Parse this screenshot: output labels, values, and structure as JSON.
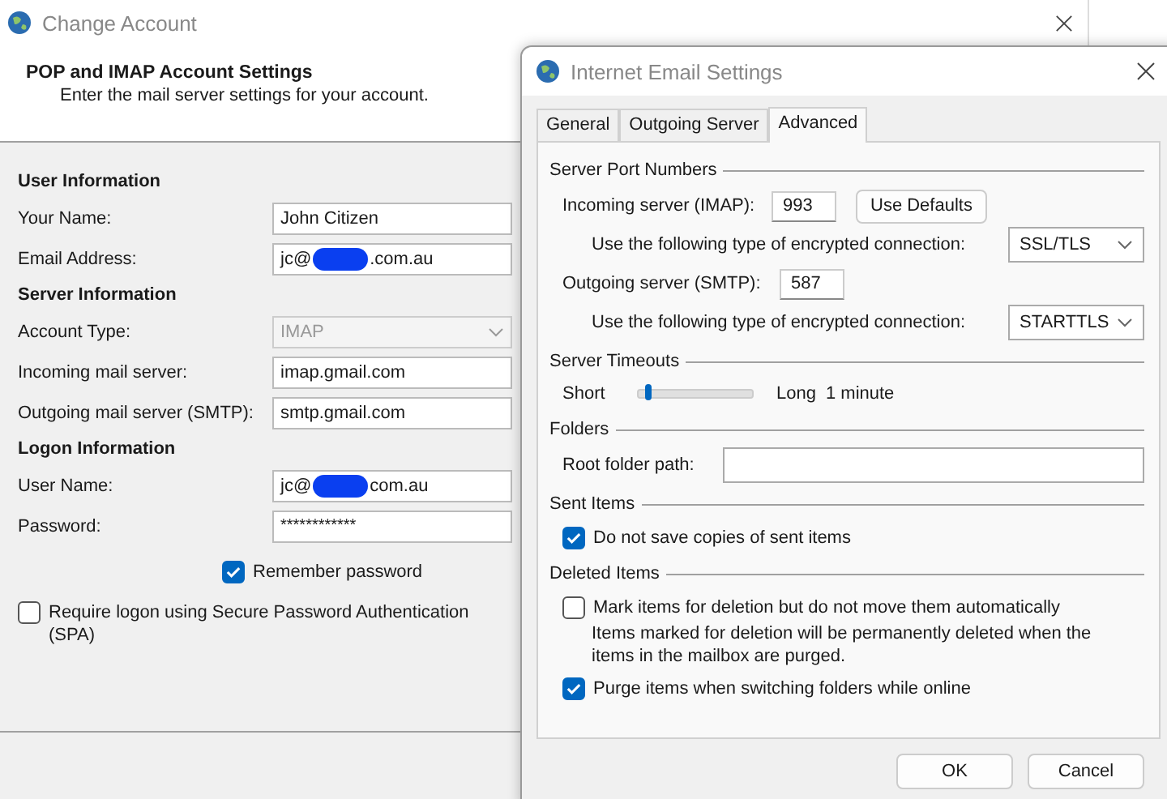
{
  "back_window": {
    "title": "Change Account",
    "heading": "POP and IMAP Account Settings",
    "subheading": "Enter the mail server settings for your account.",
    "sections": [
      {
        "title": "User Information",
        "rows": [
          {
            "label": "Your Name:",
            "kind": "text",
            "value": "John Citizen"
          },
          {
            "label": "Email Address:",
            "kind": "redacted",
            "prefix": "jc@",
            "suffix": ".com.au"
          }
        ]
      },
      {
        "title": "Server Information",
        "rows": [
          {
            "label": "Account Type:",
            "kind": "select",
            "value": "IMAP",
            "disabled": true
          },
          {
            "label": "Incoming mail server:",
            "kind": "text",
            "value": "imap.gmail.com"
          },
          {
            "label": "Outgoing mail server (SMTP):",
            "kind": "text",
            "value": "smtp.gmail.com"
          }
        ]
      },
      {
        "title": "Logon Information",
        "rows": [
          {
            "label": "User Name:",
            "kind": "redacted",
            "prefix": "jc@",
            "suffix": "com.au"
          },
          {
            "label": "Password:",
            "kind": "password",
            "value": "************"
          }
        ]
      }
    ],
    "remember": {
      "label": "Remember password",
      "checked": true
    },
    "spa": {
      "label": "Require logon using Secure Password Authentication (SPA)",
      "checked": false
    }
  },
  "dialog": {
    "title": "Internet Email Settings",
    "tabs": [
      {
        "label": "General",
        "selected": false
      },
      {
        "label": "Outgoing Server",
        "selected": false
      },
      {
        "label": "Advanced",
        "selected": true
      }
    ],
    "ports": {
      "title": "Server Port Numbers",
      "incoming_label": "Incoming server (IMAP):",
      "incoming_port": "993",
      "defaults_button": "Use Defaults",
      "incoming_enc_label": "Use the following type of encrypted connection:",
      "incoming_enc": "SSL/TLS",
      "outgoing_label": "Outgoing server (SMTP):",
      "outgoing_port": "587",
      "outgoing_enc_label": "Use the following type of encrypted connection:",
      "outgoing_enc": "STARTTLS"
    },
    "timeouts": {
      "title": "Server Timeouts",
      "min_label": "Short",
      "level": 0.05,
      "max_label": "Long",
      "reading": "1 minute"
    },
    "folders": {
      "title": "Folders",
      "root_label": "Root folder path:"
    },
    "sent": {
      "title": "Sent Items",
      "options": [
        {
          "label": "Do not save copies of sent items",
          "checked": true
        }
      ]
    },
    "deleted": {
      "title": "Deleted Items",
      "options": [
        {
          "label": "Mark items for deletion but do not move them automatically",
          "checked": false,
          "note": "Items marked for deletion will be permanently deleted when the items in the mailbox are purged."
        },
        {
          "label": "Purge items when switching folders while online",
          "checked": true
        }
      ]
    },
    "buttons": [
      "OK",
      "Cancel"
    ]
  }
}
